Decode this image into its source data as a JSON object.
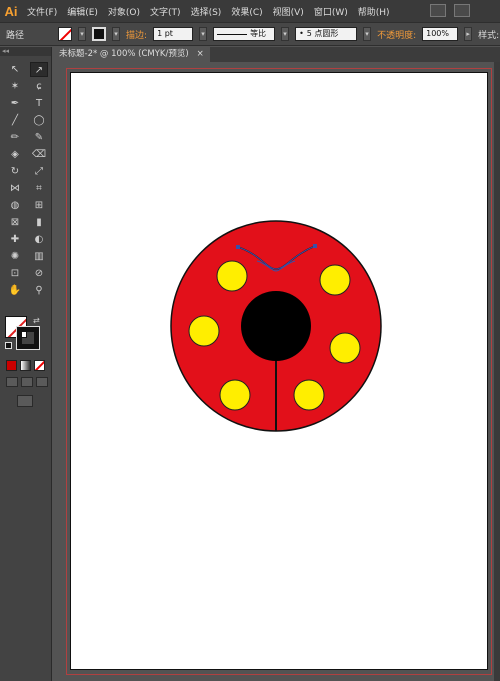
{
  "app": {
    "logo": "Ai"
  },
  "menu": [
    "文件(F)",
    "编辑(E)",
    "对象(O)",
    "文字(T)",
    "选择(S)",
    "效果(C)",
    "视图(V)",
    "窗口(W)",
    "帮助(H)"
  ],
  "control_bar": {
    "object_type": "路径",
    "stroke_label": "描边:",
    "stroke_weight": "1 pt",
    "profile": "等比",
    "brush": "5 点圆形",
    "opacity_label": "不透明度:",
    "opacity_value": "100%",
    "style_label": "样式:"
  },
  "document_tab": {
    "title": "未标题-2* @ 100% (CMYK/预览)",
    "close": "×"
  },
  "toolpanel": {
    "grip": "◂◂",
    "tools": [
      "selection-tool",
      "direct-selection-tool",
      "magic-wand-tool",
      "lasso-tool",
      "pen-tool",
      "type-tool",
      "line-tool",
      "ellipse-tool",
      "paintbrush-tool",
      "pencil-tool",
      "blob-brush-tool",
      "eraser-tool",
      "rotate-tool",
      "scale-tool",
      "width-tool",
      "free-transform-tool",
      "shape-builder-tool",
      "perspective-grid-tool",
      "mesh-tool",
      "gradient-tool",
      "eyedropper-tool",
      "blend-tool",
      "symbol-sprayer-tool",
      "column-graph-tool",
      "artboard-tool",
      "slice-tool",
      "hand-tool",
      "zoom-tool"
    ],
    "glyphs": [
      "↖",
      "↗",
      "✶",
      "ɕ",
      "✒",
      "T",
      "╱",
      "◯",
      "✏",
      "✎",
      "◈",
      "⌫",
      "↻",
      "⤢",
      "⋈",
      "⌗",
      "◍",
      "⊞",
      "⊠",
      "▮",
      "✚",
      "◐",
      "✺",
      "▥",
      "⊡",
      "⊘",
      "✋",
      "⚲"
    ]
  },
  "colors": {
    "accent_orange": "#f29b3a",
    "ladybug_red": "#e2101a",
    "spot_yellow": "#ffee00",
    "head_black": "#000000",
    "artboard_border": "#b04040",
    "selection_path": "#3b4fa8"
  }
}
